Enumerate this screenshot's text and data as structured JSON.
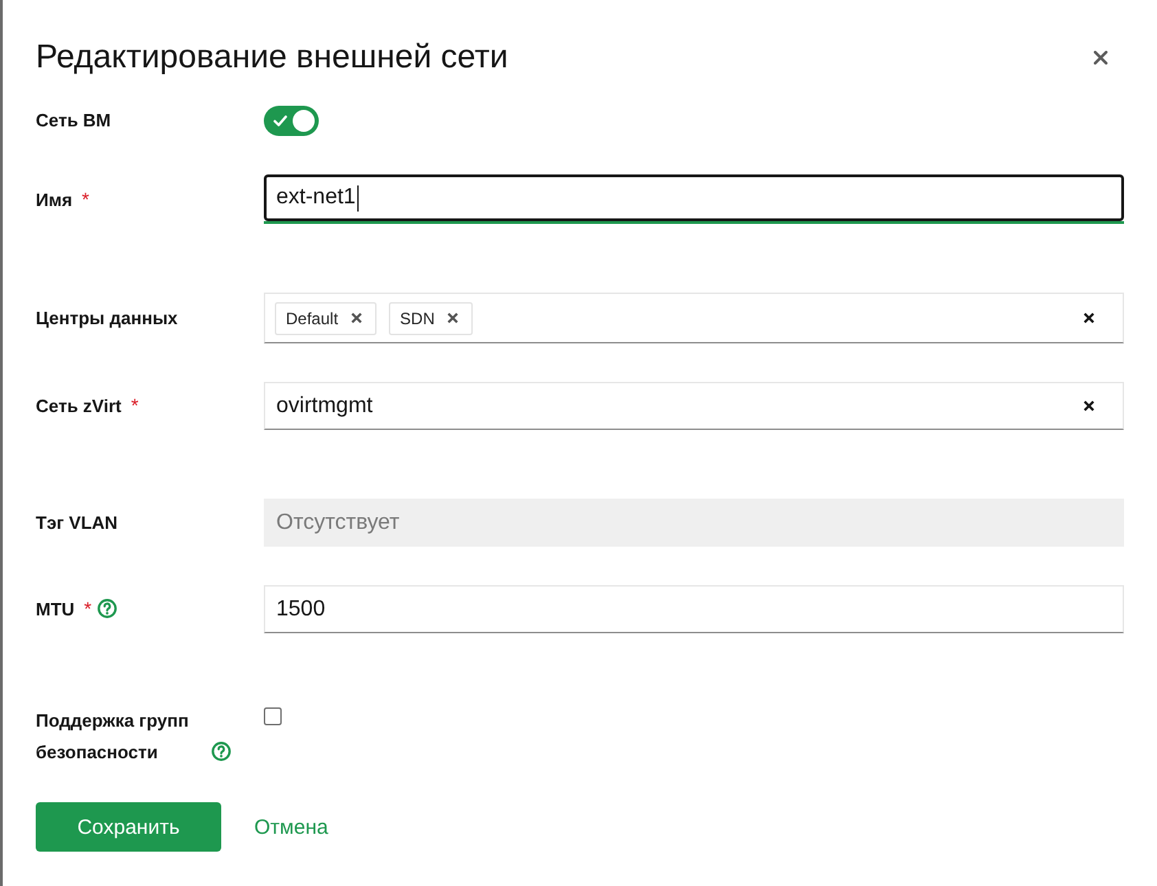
{
  "title": "Редактирование внешней сети",
  "fields": [
    {
      "kind": "toggle",
      "label": "Сеть ВМ",
      "on": true
    },
    {
      "kind": "text",
      "label": "Имя",
      "required_mark": "*",
      "value": "ext-net1",
      "focused": true
    },
    {
      "kind": "tags",
      "label": "Центры данных",
      "tags": [
        "Default",
        "SDN"
      ]
    },
    {
      "kind": "select",
      "label": "Сеть zVirt",
      "required_mark": "*",
      "value": "ovirtmgmt"
    },
    {
      "kind": "text",
      "label": "Тэг VLAN",
      "placeholder": "Отсутствует",
      "disabled": true
    },
    {
      "kind": "text",
      "label": "MTU",
      "required_mark": "*",
      "help": true,
      "value": "1500"
    },
    {
      "kind": "checkbox",
      "label": "Поддержка групп безопасности",
      "help": true,
      "checked": false
    }
  ],
  "buttons": [
    {
      "kind": "primary",
      "label": "Сохранить"
    },
    {
      "kind": "link",
      "label": "Отмена"
    }
  ]
}
